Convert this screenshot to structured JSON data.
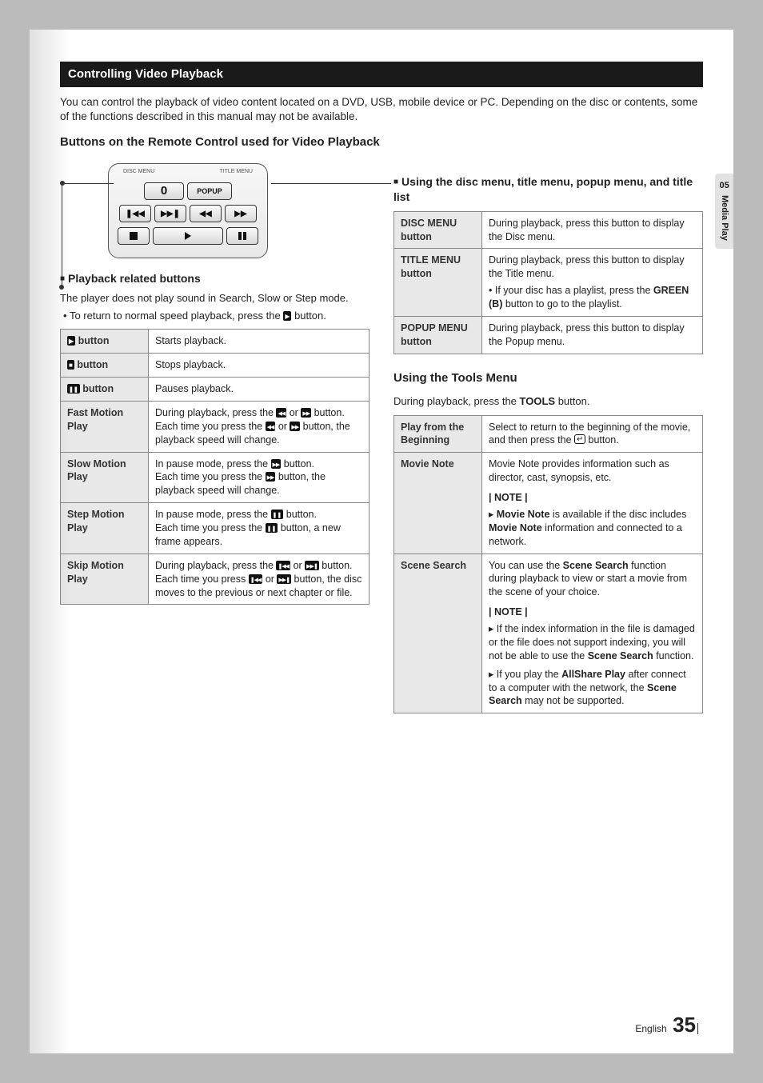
{
  "sidetab": {
    "num": "05",
    "label": "Media Play"
  },
  "section_title": "Controlling Video Playback",
  "intro": "You can control the playback of video content located on a DVD, USB, mobile device or PC. Depending on the disc or contents, some of the functions described in this manual may not be available.",
  "subhead_buttons": "Buttons on the Remote Control used for Video Playback",
  "remote": {
    "disc_menu": "DISC MENU",
    "title_menu": "TITLE MENU",
    "zero": "0",
    "popup": "POPUP"
  },
  "callout1": {
    "title": "Playback related buttons"
  },
  "callout2": {
    "title": "Using the disc menu, title menu, popup menu, and title list"
  },
  "playback_intro1": "The player does not play sound in Search, Slow or Step mode.",
  "playback_intro2": "To return to normal speed playback, press the ",
  "playback_intro2b": " button.",
  "tbl1": {
    "r1h": " button",
    "r1d": "Starts playback.",
    "r2h": " button",
    "r2d": "Stops playback.",
    "r3h": " button",
    "r3d": "Pauses playback.",
    "r4h": "Fast Motion Play",
    "r4d1": "During playback, press the ",
    "r4d2": " or ",
    "r4d3": " button.",
    "r4d4": "Each time you press the ",
    "r4d5": " or ",
    "r4d6": " button, the playback speed will change.",
    "r5h": "Slow Motion Play",
    "r5d1": "In pause mode, press the ",
    "r5d2": " button.",
    "r5d3": "Each time you press the ",
    "r5d4": " button, the playback speed will change.",
    "r6h": "Step Motion Play",
    "r6d1": "In pause mode, press the ",
    "r6d2": " button.",
    "r6d3": "Each time you press the ",
    "r6d4": " button, a new frame appears.",
    "r7h": "Skip Motion Play",
    "r7d1": "During playback, press the ",
    "r7d2": " or ",
    "r7d3": " button.",
    "r7d4": "Each time you press ",
    "r7d5": " or ",
    "r7d6": " button, the disc moves to the previous or next chapter or file."
  },
  "tbl2": {
    "r1h": "DISC MENU button",
    "r1d": "During playback, press this button to display the Disc menu.",
    "r2h": "TITLE MENU button",
    "r2d1": "During playback, press this button to display the Title menu.",
    "r2d2": "If your disc has a playlist, press the ",
    "r2d2b": "GREEN (B)",
    "r2d2c": " button to go to the playlist.",
    "r3h": "POPUP MENU button",
    "r3d": "During playback, press this button to display the Popup menu."
  },
  "tools_head": "Using the Tools Menu",
  "tools_intro1": "During playback, press the ",
  "tools_intro1b": "TOOLS",
  "tools_intro1c": " button.",
  "tbl3": {
    "r1h": "Play from the Beginning",
    "r1d1": "Select to return to the beginning of the movie, and then press the ",
    "r1d2": " button.",
    "r2h": "Movie Note",
    "r2d1": "Movie Note provides information such as director, cast, synopsis, etc.",
    "r2note": "| NOTE |",
    "r2d2a": "Movie Note",
    "r2d2b": " is available if the disc includes ",
    "r2d2c": "Movie Note",
    "r2d2d": " information and connected to a network.",
    "r3h": "Scene Search",
    "r3d1a": "You can use the ",
    "r3d1b": "Scene Search",
    "r3d1c": " function during playback to view or start a movie from the scene of your choice.",
    "r3note": "| NOTE |",
    "r3d2a": "If the index information in the file is damaged or the file does not support indexing, you will not be able to use the ",
    "r3d2b": "Scene Search",
    "r3d2c": " function.",
    "r3d3a": "If you play the ",
    "r3d3b": "AllShare Play",
    "r3d3c": " after connect to a computer with the network, the ",
    "r3d3d": "Scene Search",
    "r3d3e": " may not be supported."
  },
  "footer": {
    "lang": "English",
    "page": "35"
  }
}
